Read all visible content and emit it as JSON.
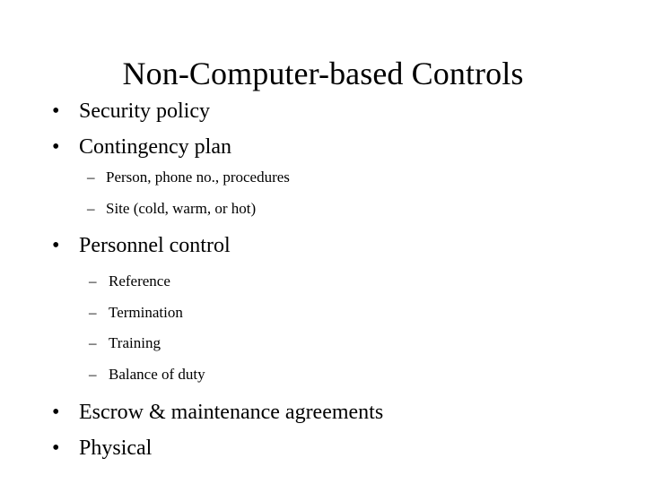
{
  "slide": {
    "title": "Non-Computer-based Controls",
    "background_color": "#ffffff",
    "text_color": "#000000",
    "markers": {
      "level1": "•",
      "level2": "–"
    },
    "outline": [
      {
        "level": 1,
        "text": "Security policy"
      },
      {
        "level": 1,
        "text": "Contingency plan"
      },
      {
        "level": 2,
        "text": "Person, phone no., procedures"
      },
      {
        "level": 2,
        "text": "Site (cold, warm, or hot)"
      },
      {
        "level": 1,
        "text": "Personnel control"
      },
      {
        "level": 2,
        "text": "Reference"
      },
      {
        "level": 2,
        "text": "Termination"
      },
      {
        "level": 2,
        "text": "Training"
      },
      {
        "level": 2,
        "text": "Balance of duty"
      },
      {
        "level": 1,
        "text": "Escrow & maintenance agreements"
      },
      {
        "level": 1,
        "text": "Physical"
      }
    ]
  }
}
